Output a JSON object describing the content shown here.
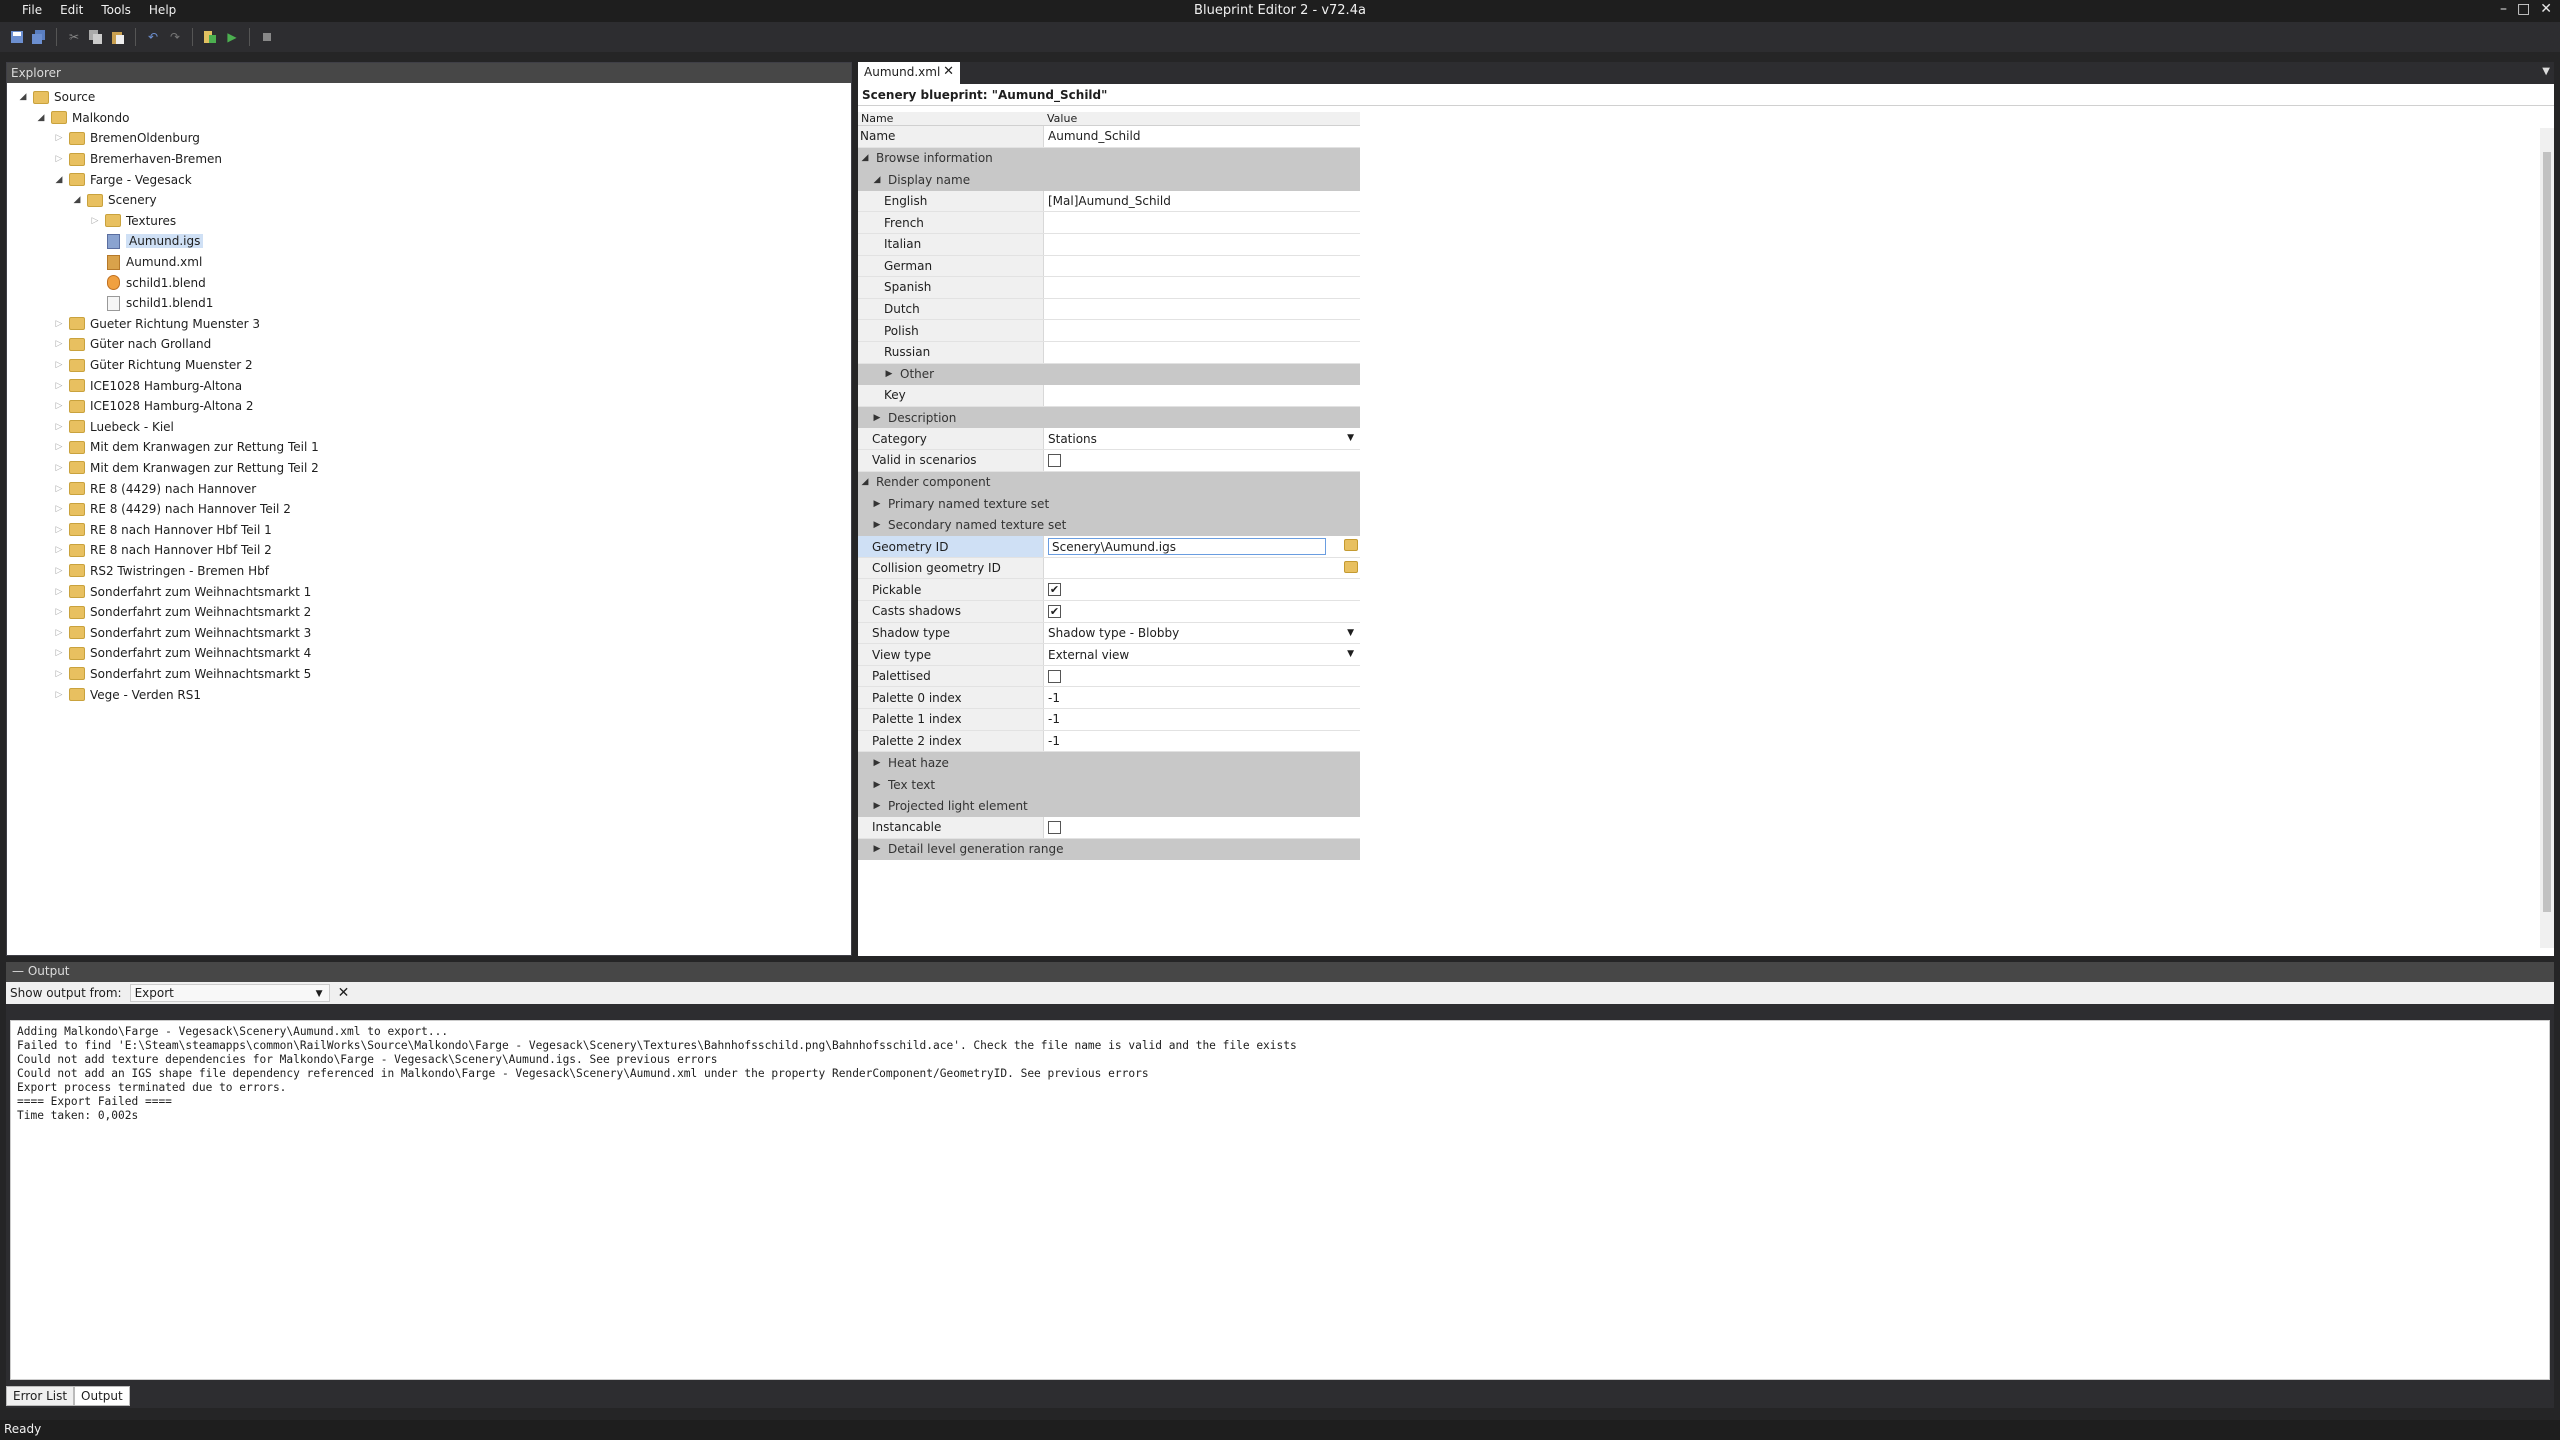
{
  "app": {
    "title": "Blueprint Editor 2 - v72.4a"
  },
  "menu": [
    "File",
    "Edit",
    "Tools",
    "Help"
  ],
  "window_controls": [
    "–",
    "□",
    "✕"
  ],
  "explorer": {
    "title": "Explorer",
    "tree": [
      {
        "label": "Source",
        "level": 0,
        "type": "folder",
        "expanded": true
      },
      {
        "label": "Malkondo",
        "level": 1,
        "type": "folder",
        "expanded": true
      },
      {
        "label": "BremenOldenburg",
        "level": 2,
        "type": "folder"
      },
      {
        "label": "Bremerhaven-Bremen",
        "level": 2,
        "type": "folder"
      },
      {
        "label": "Farge - Vegesack",
        "level": 2,
        "type": "folder",
        "expanded": true
      },
      {
        "label": "Scenery",
        "level": 3,
        "type": "folder",
        "expanded": true
      },
      {
        "label": "Textures",
        "level": 4,
        "type": "folder"
      },
      {
        "label": "Aumund.igs",
        "level": 4,
        "type": "igs",
        "selected": true
      },
      {
        "label": "Aumund.xml",
        "level": 4,
        "type": "xml"
      },
      {
        "label": "schild1.blend",
        "level": 4,
        "type": "blend"
      },
      {
        "label": "schild1.blend1",
        "level": 4,
        "type": "file"
      },
      {
        "label": "Gueter Richtung Muenster 3",
        "level": 2,
        "type": "folder"
      },
      {
        "label": "Güter nach Grolland",
        "level": 2,
        "type": "folder"
      },
      {
        "label": "Güter Richtung Muenster 2",
        "level": 2,
        "type": "folder"
      },
      {
        "label": "ICE1028 Hamburg-Altona",
        "level": 2,
        "type": "folder"
      },
      {
        "label": "ICE1028 Hamburg-Altona 2",
        "level": 2,
        "type": "folder"
      },
      {
        "label": "Luebeck - Kiel",
        "level": 2,
        "type": "folder"
      },
      {
        "label": "Mit dem Kranwagen zur Rettung Teil 1",
        "level": 2,
        "type": "folder"
      },
      {
        "label": "Mit dem Kranwagen zur Rettung Teil 2",
        "level": 2,
        "type": "folder"
      },
      {
        "label": "RE 8 (4429) nach Hannover",
        "level": 2,
        "type": "folder"
      },
      {
        "label": "RE 8 (4429) nach Hannover Teil 2",
        "level": 2,
        "type": "folder"
      },
      {
        "label": "RE 8 nach Hannover Hbf Teil 1",
        "level": 2,
        "type": "folder"
      },
      {
        "label": "RE 8 nach Hannover Hbf Teil 2",
        "level": 2,
        "type": "folder"
      },
      {
        "label": "RS2 Twistringen - Bremen Hbf",
        "level": 2,
        "type": "folder"
      },
      {
        "label": "Sonderfahrt zum Weihnachtsmarkt 1",
        "level": 2,
        "type": "folder"
      },
      {
        "label": "Sonderfahrt zum Weihnachtsmarkt 2",
        "level": 2,
        "type": "folder"
      },
      {
        "label": "Sonderfahrt zum Weihnachtsmarkt 3",
        "level": 2,
        "type": "folder"
      },
      {
        "label": "Sonderfahrt zum Weihnachtsmarkt 4",
        "level": 2,
        "type": "folder"
      },
      {
        "label": "Sonderfahrt zum Weihnachtsmarkt 5",
        "level": 2,
        "type": "folder"
      },
      {
        "label": "Vege - Verden RS1",
        "level": 2,
        "type": "folder"
      }
    ]
  },
  "editor": {
    "tab_label": "Aumund.xml",
    "blueprint_title": "Scenery blueprint: \"Aumund_Schild\"",
    "col_name": "Name",
    "col_value": "Value",
    "rows": [
      {
        "kind": "prop",
        "indent": 0,
        "name": "Name",
        "value": "Aumund_Schild"
      },
      {
        "kind": "section",
        "indent": 0,
        "name": "Browse information",
        "expanded": true
      },
      {
        "kind": "section",
        "indent": 1,
        "name": "Display name",
        "expanded": true
      },
      {
        "kind": "prop",
        "indent": 2,
        "name": "English",
        "value": "[Mal]Aumund_Schild"
      },
      {
        "kind": "prop",
        "indent": 2,
        "name": "French",
        "value": ""
      },
      {
        "kind": "prop",
        "indent": 2,
        "name": "Italian",
        "value": ""
      },
      {
        "kind": "prop",
        "indent": 2,
        "name": "German",
        "value": ""
      },
      {
        "kind": "prop",
        "indent": 2,
        "name": "Spanish",
        "value": ""
      },
      {
        "kind": "prop",
        "indent": 2,
        "name": "Dutch",
        "value": ""
      },
      {
        "kind": "prop",
        "indent": 2,
        "name": "Polish",
        "value": ""
      },
      {
        "kind": "prop",
        "indent": 2,
        "name": "Russian",
        "value": ""
      },
      {
        "kind": "section",
        "indent": 2,
        "name": "Other",
        "expanded": false
      },
      {
        "kind": "prop",
        "indent": 2,
        "name": "Key",
        "value": ""
      },
      {
        "kind": "section",
        "indent": 1,
        "name": "Description",
        "expanded": false
      },
      {
        "kind": "dropdown",
        "indent": 1,
        "name": "Category",
        "value": "Stations"
      },
      {
        "kind": "check",
        "indent": 1,
        "name": "Valid in scenarios",
        "checked": false
      },
      {
        "kind": "section",
        "indent": 0,
        "name": "Render component",
        "expanded": true
      },
      {
        "kind": "section",
        "indent": 1,
        "name": "Primary named texture set",
        "expanded": false
      },
      {
        "kind": "section",
        "indent": 1,
        "name": "Secondary named texture set",
        "expanded": false
      },
      {
        "kind": "input",
        "indent": 1,
        "name": "Geometry ID",
        "value": "Scenery\\Aumund.igs",
        "highlight": true,
        "browse": true
      },
      {
        "kind": "prop",
        "indent": 1,
        "name": "Collision geometry ID",
        "value": "",
        "browse": true
      },
      {
        "kind": "check",
        "indent": 1,
        "name": "Pickable",
        "checked": true
      },
      {
        "kind": "check",
        "indent": 1,
        "name": "Casts shadows",
        "checked": true
      },
      {
        "kind": "dropdown",
        "indent": 1,
        "name": "Shadow type",
        "value": "Shadow type - Blobby"
      },
      {
        "kind": "dropdown",
        "indent": 1,
        "name": "View type",
        "value": "External view"
      },
      {
        "kind": "check",
        "indent": 1,
        "name": "Palettised",
        "checked": false
      },
      {
        "kind": "prop",
        "indent": 1,
        "name": "Palette 0 index",
        "value": "-1"
      },
      {
        "kind": "prop",
        "indent": 1,
        "name": "Palette 1 index",
        "value": "-1"
      },
      {
        "kind": "prop",
        "indent": 1,
        "name": "Palette 2 index",
        "value": "-1"
      },
      {
        "kind": "section",
        "indent": 1,
        "name": "Heat haze",
        "expanded": false
      },
      {
        "kind": "section",
        "indent": 1,
        "name": "Tex text",
        "expanded": false
      },
      {
        "kind": "section",
        "indent": 1,
        "name": "Projected light element",
        "expanded": false
      },
      {
        "kind": "check",
        "indent": 1,
        "name": "Instancable",
        "checked": false
      },
      {
        "kind": "section",
        "indent": 1,
        "name": "Detail level generation range",
        "expanded": false
      }
    ]
  },
  "output": {
    "title": "Output",
    "show_from_label": "Show output from:",
    "source": "Export",
    "lines": [
      "Adding Malkondo\\Farge - Vegesack\\Scenery\\Aumund.xml to export...",
      "Failed to find 'E:\\Steam\\steamapps\\common\\RailWorks\\Source\\Malkondo\\Farge - Vegesack\\Scenery\\Textures\\Bahnhofsschild.png\\Bahnhofsschild.ace'. Check the file name is valid and the file exists",
      "Could not add texture dependencies for Malkondo\\Farge - Vegesack\\Scenery\\Aumund.igs. See previous errors",
      "Could not add an IGS shape file dependency referenced in Malkondo\\Farge - Vegesack\\Scenery\\Aumund.xml under the property RenderComponent/GeometryID. See previous errors",
      "Export process terminated due to errors.",
      "==== Export Failed ====",
      "Time taken: 0,002s"
    ],
    "tabs": [
      "Error List",
      "Output"
    ]
  },
  "status": {
    "text": "Ready"
  },
  "icons": {
    "folder_color": "#e8c060",
    "highlight_color": "#cfe0f5"
  }
}
